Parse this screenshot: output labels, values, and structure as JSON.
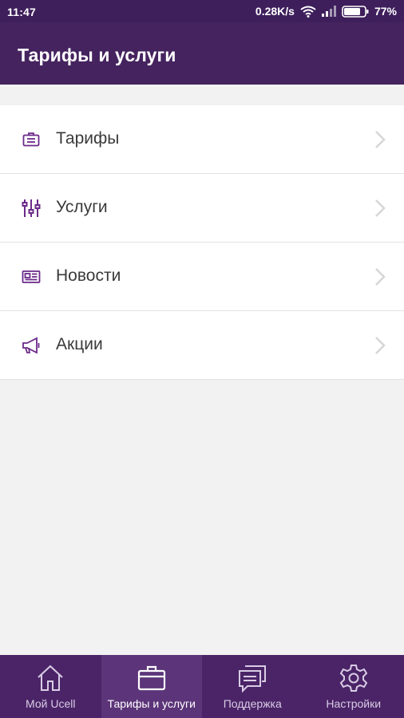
{
  "status_bar": {
    "time": "11:47",
    "network_speed": "0.28K/s",
    "battery": "77%",
    "icons": [
      "wifi-icon",
      "signal-icon",
      "battery-icon"
    ]
  },
  "header": {
    "title": "Тарифы и услуги"
  },
  "menu": {
    "items": [
      {
        "label": "Тарифы",
        "icon": "tariff-badge-icon"
      },
      {
        "label": "Услуги",
        "icon": "sliders-icon"
      },
      {
        "label": "Новости",
        "icon": "newspaper-icon"
      },
      {
        "label": "Акции",
        "icon": "megaphone-icon"
      }
    ]
  },
  "bottom_nav": {
    "tabs": [
      {
        "label": "Мой Ucell",
        "icon": "home-icon",
        "active": false
      },
      {
        "label": "Тарифы и услуги",
        "icon": "briefcase-icon",
        "active": true
      },
      {
        "label": "Поддержка",
        "icon": "chat-icon",
        "active": false
      },
      {
        "label": "Настройки",
        "icon": "gear-icon",
        "active": false
      }
    ]
  },
  "colors": {
    "status_bar": "#3e1f5c",
    "app_bar": "#45235f",
    "bottom_nav": "#4b2468",
    "bottom_nav_active": "#5c3479",
    "accent_icon": "#6b2a8a",
    "background": "#f2f2f2"
  }
}
